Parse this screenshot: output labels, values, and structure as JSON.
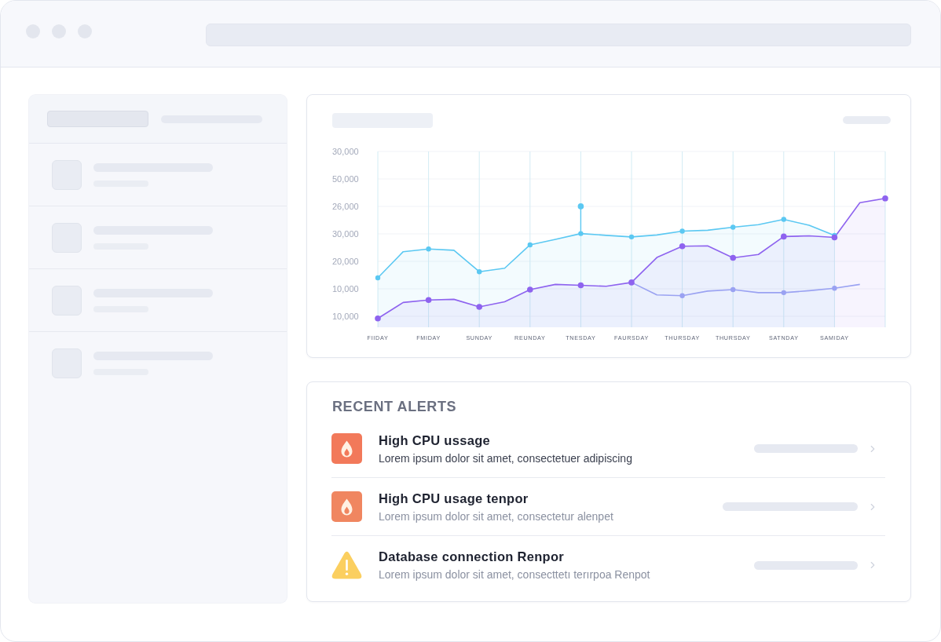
{
  "chart": {
    "y_axis_labels": [
      "30,000",
      "50,000",
      "26,000",
      "30,000",
      "20,000",
      "10,000",
      "10,000"
    ],
    "x_axis_labels": [
      "FIIDAY",
      "FMIDAY",
      "SUNDAY",
      "REUNDAY",
      "TNESDAY",
      "FAURSDAY",
      "THURSDAY",
      "THURSDAY",
      "SATNDAY",
      "SAMIDAY"
    ]
  },
  "alerts": {
    "title": "RECENT ALERTS",
    "items": [
      {
        "kind": "fire",
        "color": "#f2795a",
        "title": "High CPU ussage",
        "description": "Lorem ipsum dolor sit amet, consectetuer adipiscing",
        "unread": true
      },
      {
        "kind": "fire",
        "color": "#f08660",
        "title": "High CPU usage tenpor",
        "description": "Lorem ipsum dolor sit amet, consectetur alenpet",
        "unread": false
      },
      {
        "kind": "warning",
        "color": "#fbcf5f",
        "title": "Database connection Renpor",
        "description": "Lorem ipsum dolor sit amet, consecttetı terırpoa Renpot",
        "unread": false
      }
    ]
  }
}
